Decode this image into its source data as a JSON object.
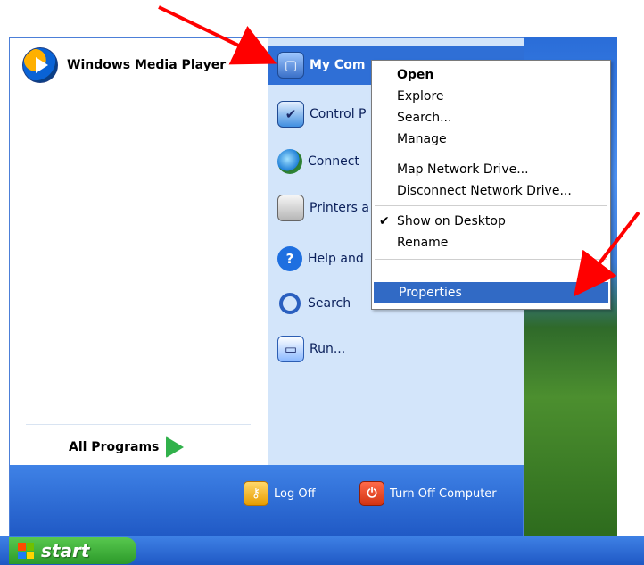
{
  "left_panel": {
    "pinned": [
      {
        "label": "Windows Media Player",
        "icon": "windows-media-player-icon"
      }
    ],
    "all_programs_label": "All Programs"
  },
  "right_panel": {
    "items": [
      {
        "label": "My Com",
        "icon": "my-computer-icon",
        "highlighted": true
      },
      {
        "label": "Control P",
        "icon": "control-panel-icon"
      },
      {
        "label": "Connect",
        "icon": "connect-icon"
      },
      {
        "label": "Printers a",
        "icon": "printers-icon"
      },
      {
        "label": "Help and",
        "icon": "help-icon"
      },
      {
        "label": "Search",
        "icon": "search-icon"
      },
      {
        "label": "Run...",
        "icon": "run-icon"
      }
    ]
  },
  "bottom_bar": {
    "log_off": "Log Off",
    "turn_off": "Turn Off Computer"
  },
  "taskbar": {
    "start_label": "start"
  },
  "context_menu": {
    "items": [
      {
        "label": "Open",
        "bold": true
      },
      {
        "label": "Explore"
      },
      {
        "label": "Search..."
      },
      {
        "label": "Manage"
      },
      {
        "label": "Map Network Drive..."
      },
      {
        "label": "Disconnect Network Drive..."
      },
      {
        "label": "Show on Desktop",
        "checked": true
      },
      {
        "label": "Rename"
      },
      {
        "label": "Properties",
        "selected": true
      }
    ]
  },
  "colors": {
    "accent_blue": "#2f6fd6",
    "menu_right_bg": "#d3e5fa",
    "start_green": "#3aa83a",
    "selection_blue": "#316ac5",
    "arrow_red": "#ff0000"
  }
}
